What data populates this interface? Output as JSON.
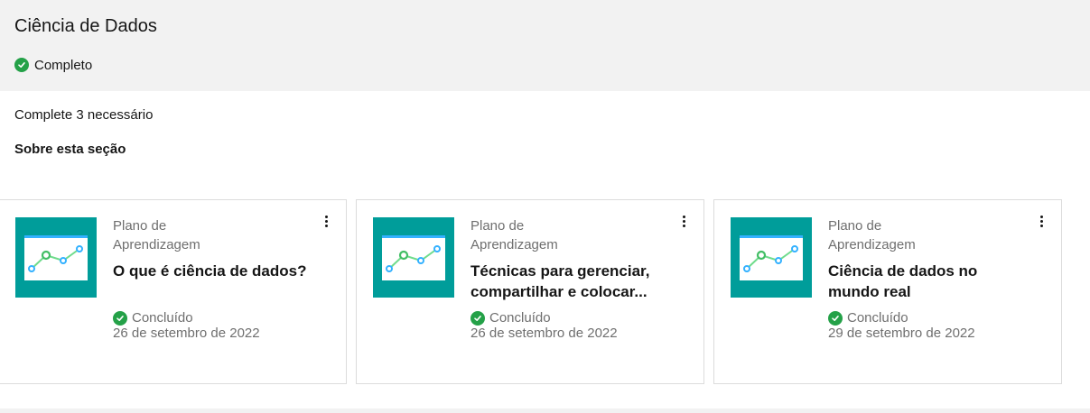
{
  "section": {
    "title": "Ciência de Dados",
    "status": "Completo",
    "requirement": "Complete 3 necessário",
    "about_label": "Sobre esta seção"
  },
  "colors": {
    "header_bg": "#f2f2f2",
    "complete_green": "#24a148",
    "thumbnail_teal": "#009d9a"
  },
  "cards": [
    {
      "type": "Plano de Aprendizagem",
      "title": "O que é ciência de dados?",
      "status": "Concluído",
      "date": "26 de setembro de 2022",
      "icon": "line-chart-thumbnail"
    },
    {
      "type": "Plano de Aprendizagem",
      "title": "Técnicas para gerenciar, compartilhar e colocar...",
      "status": "Concluído",
      "date": "26 de setembro de 2022",
      "icon": "line-chart-thumbnail"
    },
    {
      "type": "Plano de Aprendizagem",
      "title": "Ciência de dados no mundo real",
      "status": "Concluído",
      "date": "29 de setembro de 2022",
      "icon": "line-chart-thumbnail"
    }
  ]
}
